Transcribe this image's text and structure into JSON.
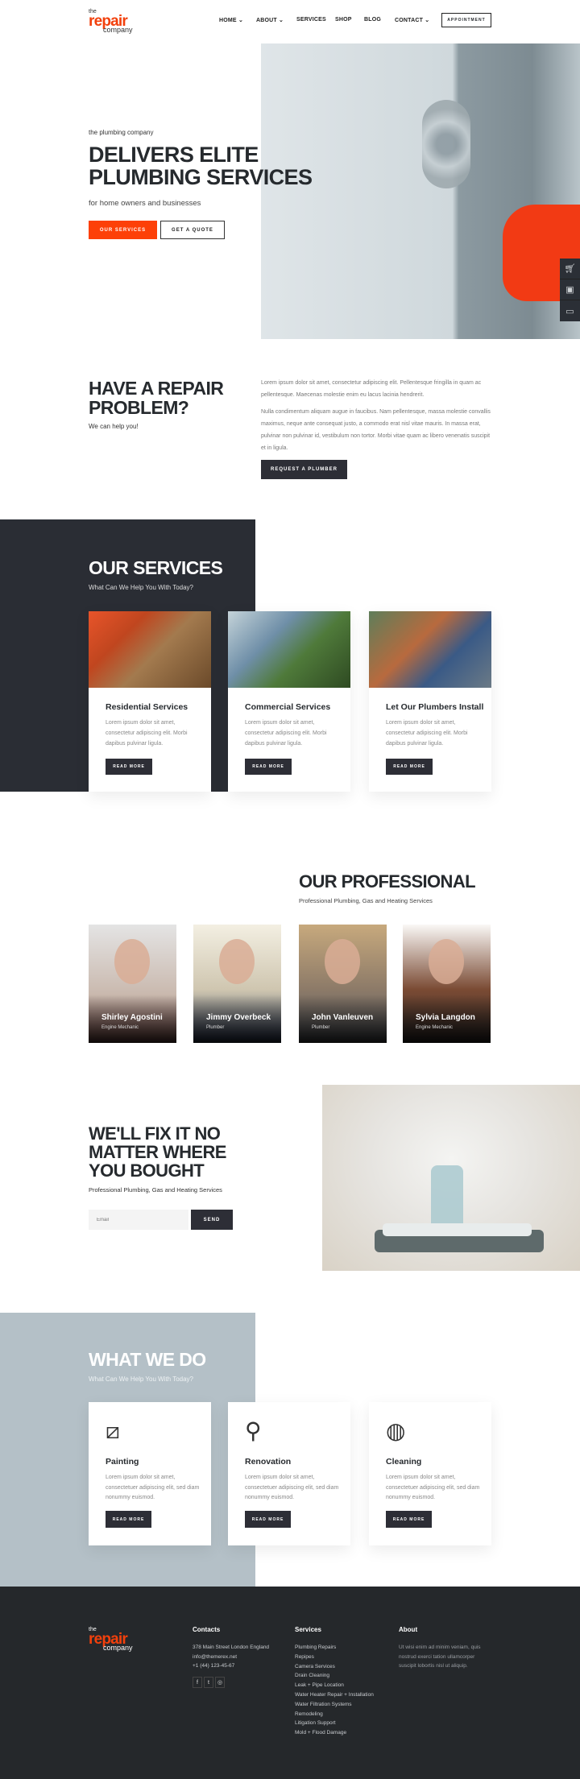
{
  "header": {
    "logo": {
      "the": "the",
      "repair": "repair",
      "company": "company"
    },
    "nav": [
      {
        "label": "HOME",
        "dropdown": true
      },
      {
        "label": "ABOUT",
        "dropdown": true
      },
      {
        "label": "SERVICES"
      },
      {
        "label": "SHOP"
      },
      {
        "label": "BLOG"
      },
      {
        "label": "CONTACT",
        "dropdown": true
      }
    ],
    "appointment": "APPOINTMENT"
  },
  "hero": {
    "eyebrow": "the plumbing company",
    "title1": "DELIVERS ELITE",
    "title2": "PLUMBING SERVICES",
    "subtitle": "for home owners and businesses",
    "btn_primary": "OUR SERVICES",
    "btn_secondary": "GET A QUOTE"
  },
  "side_widget": [
    "cart-icon",
    "contact-icon",
    "window-icon"
  ],
  "repair": {
    "title1": "HAVE A REPAIR",
    "title2": "PROBLEM?",
    "subtitle": "We can help you!",
    "p1": "Lorem ipsum dolor sit amet, consectetur adipiscing elit. Pellentesque fringilla in quam ac pellentesque. Maecenas molestie enim eu lacus lacinia hendrerit.",
    "p2": "Nulla condimentum aliquam augue in faucibus. Nam pellentesque, massa molestie convallis maximus, neque ante consequat justo, a commodo erat nisl vitae mauris. In massa erat, pulvinar non pulvinar id, vestibulum non tortor. Morbi vitae quam ac libero venenatis suscipit et in ligula.",
    "button": "REQUEST A PLUMBER"
  },
  "services": {
    "title": "OUR SERVICES",
    "subtitle": "What Can We Help You With Today?",
    "cards": [
      {
        "title": "Residential Services",
        "text": "Lorem ipsum dolor sit amet, consectetur adipiscing elit. Morbi dapibus pulvinar ligula.",
        "button": "READ MORE"
      },
      {
        "title": "Commercial Services",
        "text": "Lorem ipsum dolor sit amet, consectetur adipiscing elit. Morbi dapibus pulvinar ligula.",
        "button": "READ MORE"
      },
      {
        "title": "Let Our Plumbers Install",
        "text": "Lorem ipsum dolor sit amet, consectetur adipiscing elit. Morbi dapibus pulvinar ligula.",
        "button": "READ MORE"
      }
    ]
  },
  "team": {
    "title": "OUR PROFESSIONAL",
    "subtitle": "Professional Plumbing, Gas and Heating Services",
    "members": [
      {
        "name": "Shirley Agostini",
        "role": "Engine Mechanic"
      },
      {
        "name": "Jimmy Overbeck",
        "role": "Plumber"
      },
      {
        "name": "John Vanleuven",
        "role": "Plumber"
      },
      {
        "name": "Sylvia Langdon",
        "role": "Engine Mechanic"
      }
    ]
  },
  "fix": {
    "title1": "WE'LL FIX IT NO",
    "title2": "MATTER WHERE",
    "title3": "YOU BOUGHT",
    "subtitle": "Professional Plumbing, Gas and Heating Services",
    "email_placeholder": "Email",
    "send": "SEND"
  },
  "whatwedo": {
    "title": "WHAT WE DO",
    "subtitle": "What Can We Help You With Today?",
    "panel_color": "#b4c0c7",
    "cards": [
      {
        "icon": "window-cleaning-icon",
        "title": "Painting",
        "text": "Lorem ipsum dolor sit amet, consectetuer adipiscing elit, sed diam nonummy euismod.",
        "button": "READ MORE"
      },
      {
        "icon": "mop-bucket-icon",
        "title": "Renovation",
        "text": "Lorem ipsum dolor sit amet, consectetuer adipiscing elit, sed diam nonummy euismod.",
        "button": "READ MORE"
      },
      {
        "icon": "dishes-icon",
        "title": "Cleaning",
        "text": "Lorem ipsum dolor sit amet, consectetuer adipiscing elit, sed diam nonummy euismod.",
        "button": "READ MORE"
      }
    ]
  },
  "footer": {
    "contacts": {
      "title": "Contacts",
      "address": "378 Main Street London England",
      "email": "info@themerex.net",
      "phone": "+1 (44) 123-45-67",
      "social": [
        "facebook-icon",
        "twitter-icon",
        "instagram-icon"
      ]
    },
    "services": {
      "title": "Services",
      "items": [
        "Plumbing Repairs",
        "Repipes",
        "Camera Services",
        "Drain Cleaning",
        "Leak + Pipe Location",
        "Water Heater Repair + Installation",
        "Water Filtration Systems",
        "Remodeling",
        "Litigation Support",
        "Mold + Flood Damage"
      ]
    },
    "about": {
      "title": "About",
      "text": "Ut wisi enim ad minim veniam, quis nostrud exerci tation ullamcorper suscipit lobortis nisl ut aliquip."
    }
  },
  "colors": {
    "accent": "#f2400c",
    "dark": "#262a2e",
    "footer": "#25282b"
  }
}
